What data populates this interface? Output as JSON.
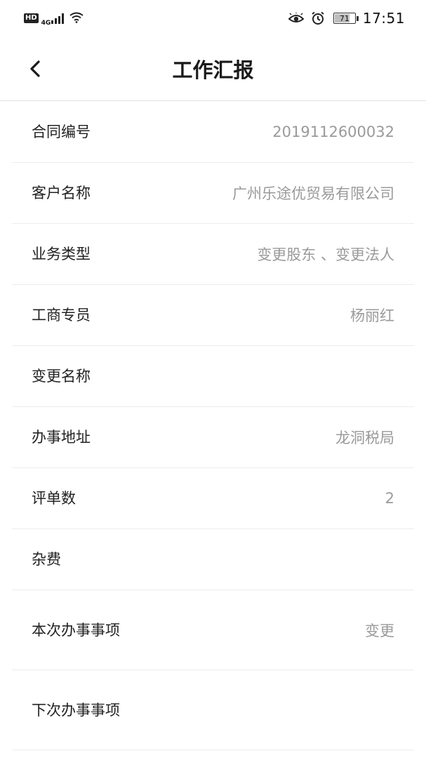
{
  "status_bar": {
    "hd": "HD",
    "network": "4G",
    "battery": "71",
    "time": "17:51"
  },
  "header": {
    "title": "工作汇报"
  },
  "form": {
    "rows": [
      {
        "label": "合同编号",
        "value": "2019112600032"
      },
      {
        "label": "客户名称",
        "value": "广州乐途优贸易有限公司"
      },
      {
        "label": "业务类型",
        "value": "变更股东 、变更法人"
      },
      {
        "label": "工商专员",
        "value": "杨丽红"
      },
      {
        "label": "变更名称",
        "value": ""
      },
      {
        "label": "办事地址",
        "value": "龙洞税局"
      },
      {
        "label": "评单数",
        "value": "2"
      },
      {
        "label": "杂费",
        "value": ""
      },
      {
        "label": "本次办事事项",
        "value": "变更"
      },
      {
        "label": "下次办事事项",
        "value": ""
      }
    ]
  }
}
